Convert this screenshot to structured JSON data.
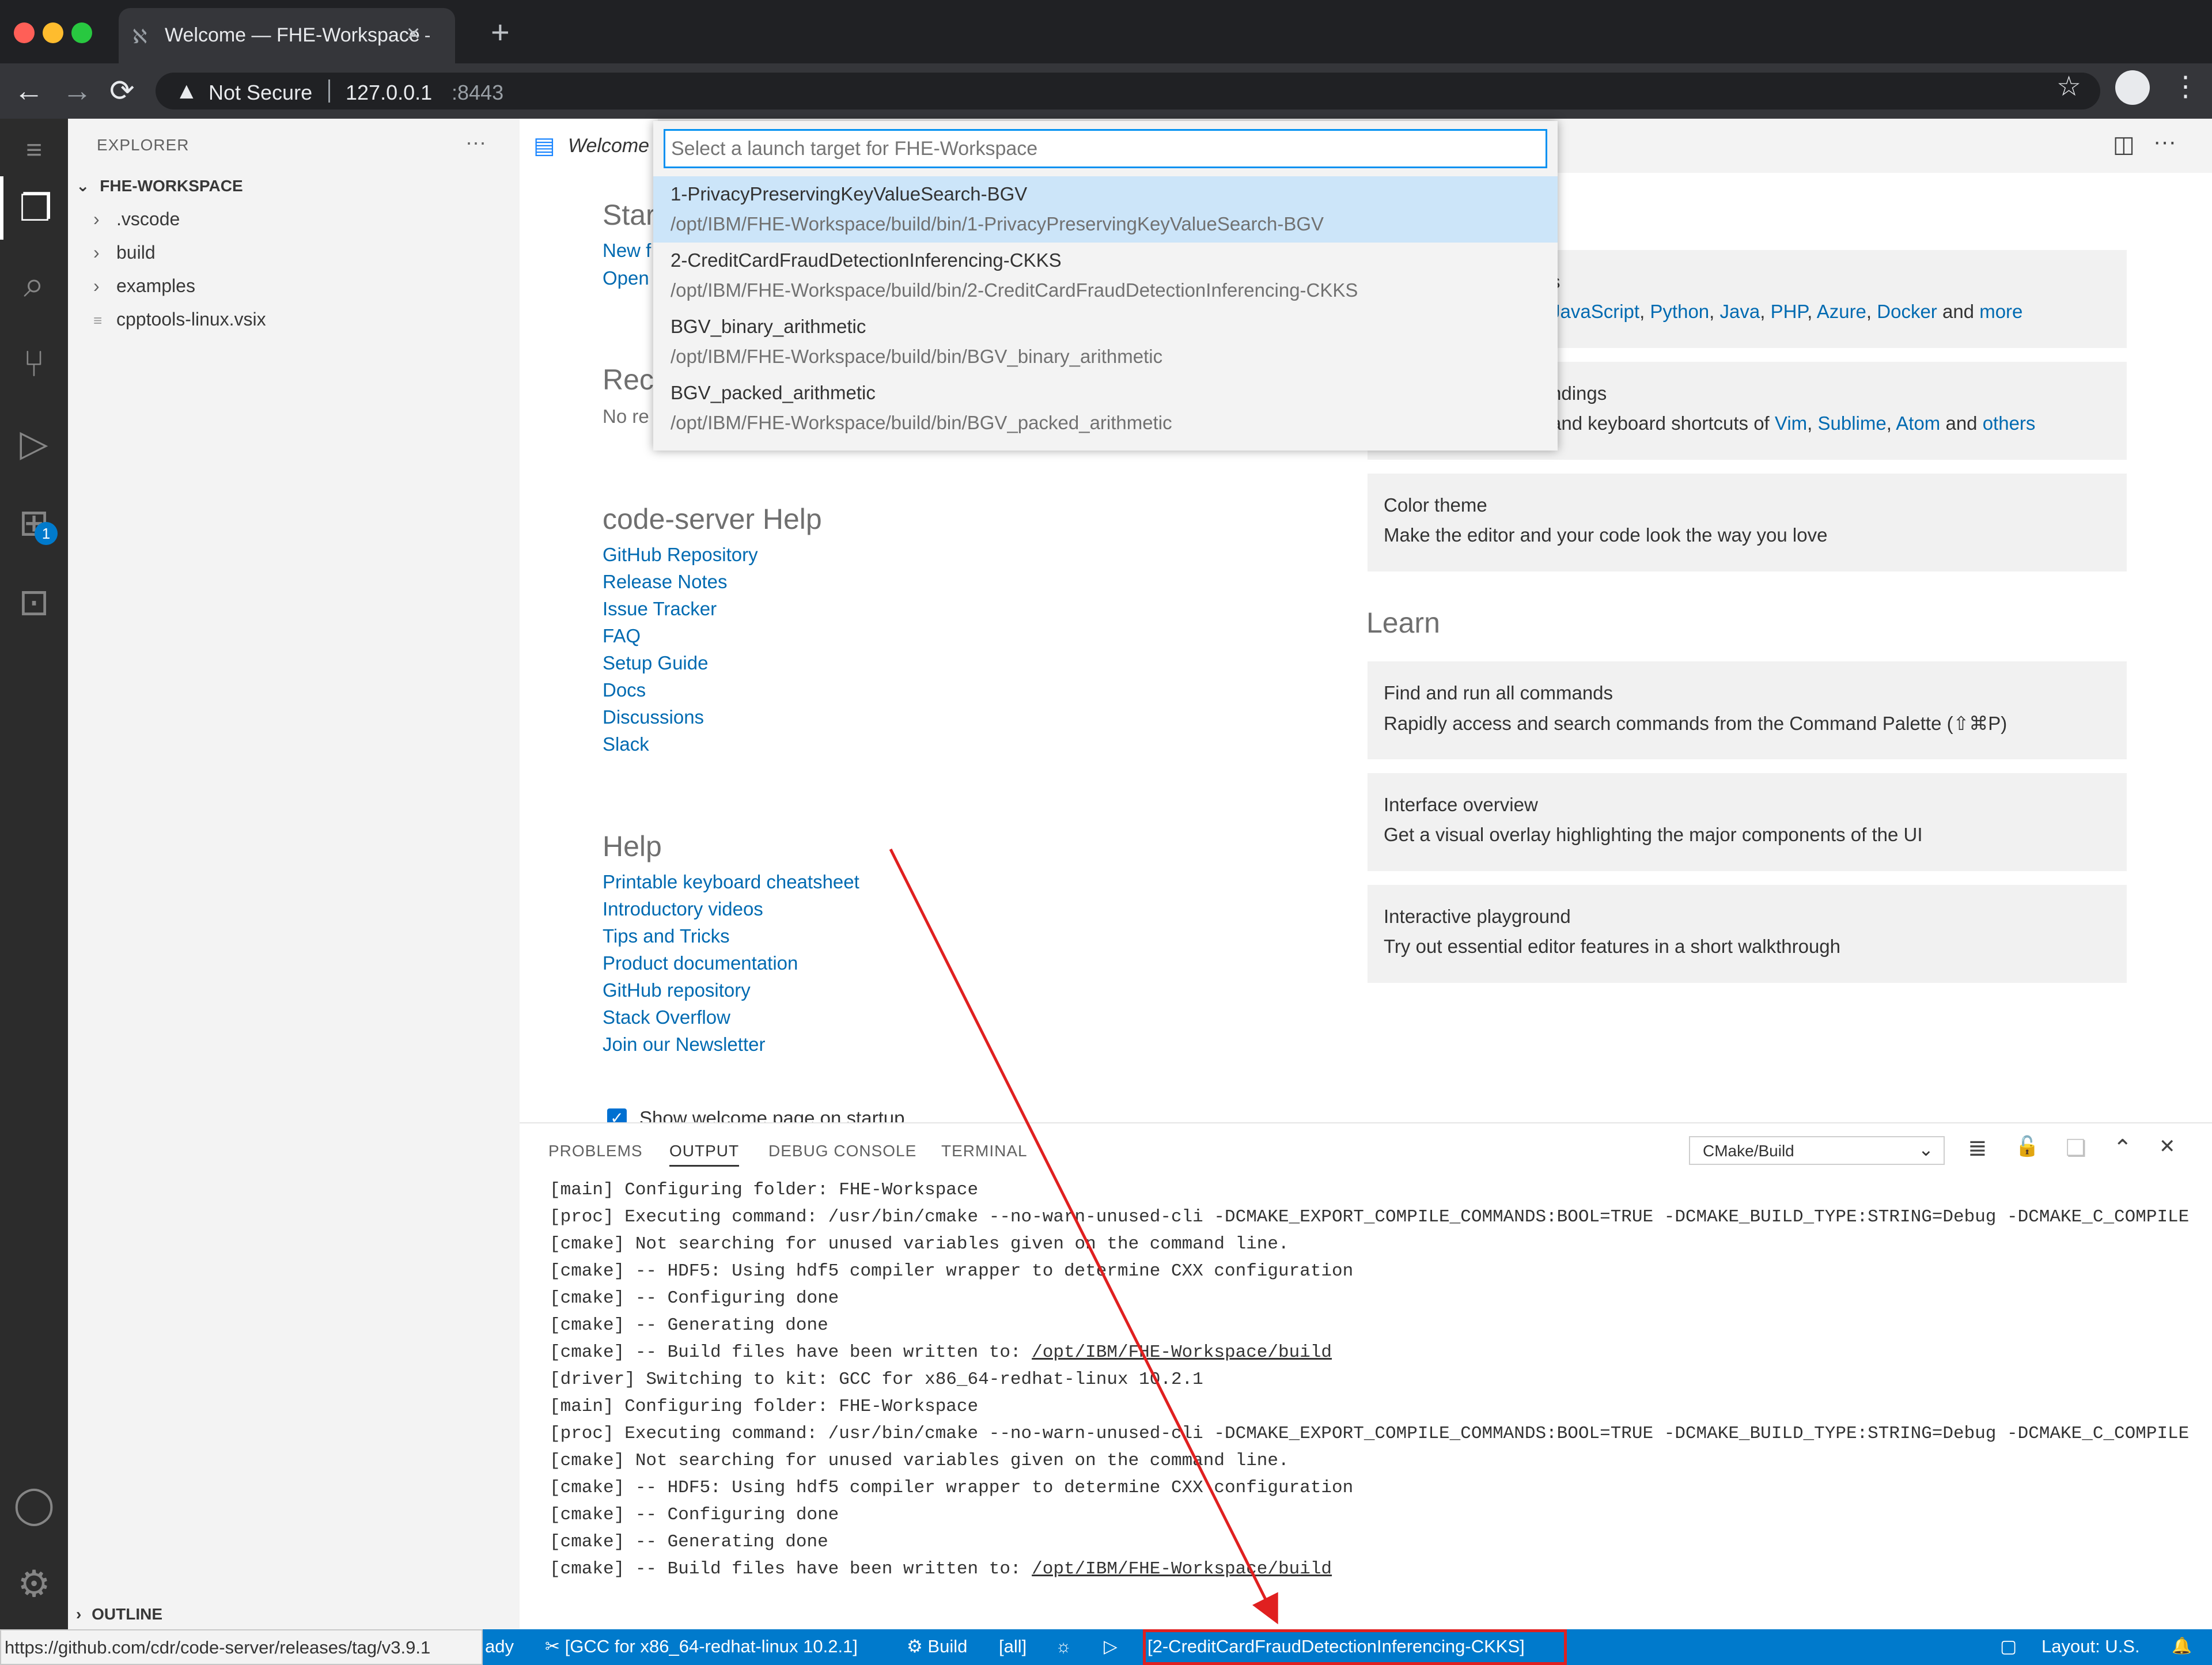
{
  "browser": {
    "tab_title": "Welcome — FHE-Workspace — code-server",
    "close_glyph": "×",
    "newtab_glyph": "+",
    "back_glyph": "←",
    "forward_glyph": "→",
    "reload_glyph": "⟳",
    "security_label": "Not Secure",
    "url_host": "127.0.0.1",
    "url_port": ":8443",
    "star_glyph": "☆",
    "menu_glyph": "⋮",
    "traffic_colors": [
      "#ff5f57",
      "#febc2e",
      "#28c840"
    ]
  },
  "activity": {
    "menu": "≡",
    "explorer": "❐",
    "search": "⌕",
    "scm": "⑂",
    "debug": "▷",
    "extensions": "⊞",
    "extensions_badge": "1",
    "remote": "⊡",
    "accounts": "◯",
    "settings": "⚙"
  },
  "sidebar": {
    "title": "EXPLORER",
    "more": "···",
    "workspace": "FHE-WORKSPACE",
    "items": [
      {
        "chev": "›",
        "label": ".vscode"
      },
      {
        "chev": "›",
        "label": "build"
      },
      {
        "chev": "›",
        "label": "examples"
      },
      {
        "chev": "≡",
        "label": "cpptools-linux.vsix"
      }
    ],
    "outline": "OUTLINE",
    "chev_down": "⌄",
    "chev_right": "›"
  },
  "editor": {
    "tab_label": "Welcome",
    "split": "◫",
    "more": "···"
  },
  "welcome": {
    "start_heading": "Star",
    "new_link": "New f",
    "open_link": "Open",
    "recent_heading": "Rec",
    "recent_text": "No re",
    "cs_help_heading": "code-server Help",
    "cs_help_links": [
      "GitHub Repository",
      "Release Notes",
      "Issue Tracker",
      "FAQ",
      "Setup Guide",
      "Docs",
      "Discussions",
      "Slack"
    ],
    "help_heading": "Help",
    "help_links": [
      "Printable keyboard cheatsheet",
      "Introductory videos",
      "Tips and Tricks",
      "Product documentation",
      "GitHub repository",
      "Stack Overflow",
      "Join our Newsletter"
    ],
    "customize_cards": {
      "tools_title": "s",
      "tools_desc_links": [
        "JavaScript",
        "Python",
        "Java",
        "PHP",
        "Azure",
        "Docker"
      ],
      "tools_and": "and",
      "tools_more": "more",
      "keys_title": "ndings",
      "keys_prefix": "and keyboard shortcuts of",
      "keys_links": [
        "Vim",
        "Sublime",
        "Atom"
      ],
      "keys_and": "and",
      "keys_others": "others",
      "color_title": "Color theme",
      "color_desc": "Make the editor and your code look the way you love"
    },
    "learn_heading": "Learn",
    "learn_cards": [
      {
        "title": "Find and run all commands",
        "desc": "Rapidly access and search commands from the Command Palette (⇧⌘P)"
      },
      {
        "title": "Interface overview",
        "desc": "Get a visual overlay highlighting the major components of the UI"
      },
      {
        "title": "Interactive playground",
        "desc": "Try out essential editor features in a short walkthrough"
      }
    ],
    "startup_check": "✓",
    "startup_label": "Show welcome page on startup"
  },
  "quickpick": {
    "placeholder": "Select a launch target for FHE-Workspace",
    "items": [
      {
        "label": "1-PrivacyPreservingKeyValueSearch-BGV",
        "desc": "/opt/IBM/FHE-Workspace/build/bin/1-PrivacyPreservingKeyValueSearch-BGV"
      },
      {
        "label": "2-CreditCardFraudDetectionInferencing-CKKS",
        "desc": "/opt/IBM/FHE-Workspace/build/bin/2-CreditCardFraudDetectionInferencing-CKKS"
      },
      {
        "label": "BGV_binary_arithmetic",
        "desc": "/opt/IBM/FHE-Workspace/build/bin/BGV_binary_arithmetic"
      },
      {
        "label": "BGV_packed_arithmetic",
        "desc": "/opt/IBM/FHE-Workspace/build/bin/BGV_packed_arithmetic"
      }
    ]
  },
  "panel": {
    "tabs": [
      "PROBLEMS",
      "OUTPUT",
      "DEBUG CONSOLE",
      "TERMINAL"
    ],
    "channel": "CMake/Build",
    "chev": "⌄",
    "icons": {
      "clear": "≣",
      "lock": "🔓",
      "copy": "❏",
      "maximize": "⌃",
      "close": "✕"
    },
    "lines": [
      "[main] Configuring folder: FHE-Workspace",
      "[proc] Executing command: /usr/bin/cmake --no-warn-unused-cli -DCMAKE_EXPORT_COMPILE_COMMANDS:BOOL=TRUE -DCMAKE_BUILD_TYPE:STRING=Debug -DCMAKE_C_COMPILE",
      "[cmake] Not searching for unused variables given on the command line.",
      "[cmake] -- HDF5: Using hdf5 compiler wrapper to determine CXX configuration",
      "[cmake] -- Configuring done",
      "[cmake] -- Generating done",
      "[cmake] -- Build files have been written to: ",
      "[driver] Switching to kit: GCC for x86_64-redhat-linux 10.2.1",
      "[main] Configuring folder: FHE-Workspace",
      "[proc] Executing command: /usr/bin/cmake --no-warn-unused-cli -DCMAKE_EXPORT_COMPILE_COMMANDS:BOOL=TRUE -DCMAKE_BUILD_TYPE:STRING=Debug -DCMAKE_C_COMPILE",
      "[cmake] Not searching for unused variables given on the command line.",
      "[cmake] -- HDF5: Using hdf5 compiler wrapper to determine CXX configuration",
      "[cmake] -- Configuring done",
      "[cmake] -- Generating done",
      "[cmake] -- Build files have been written to: "
    ],
    "build_path": "/opt/IBM/FHE-Workspace/build"
  },
  "status": {
    "hover_link": "https://github.com/cdr/code-server/releases/tag/v3.9.1",
    "ready_fragment": "ady",
    "kit": "✂ [GCC for x86_64-redhat-linux 10.2.1]",
    "build": "⚙ Build",
    "target": "[all]",
    "debug": "☼",
    "run": "▷",
    "launch_target": "[2-CreditCardFraudDetectionInferencing-CKKS]",
    "feedback": "▢",
    "layout": "Layout: U.S.",
    "bell": "🔔"
  },
  "colors": {
    "accent": "#007acc",
    "link": "#006ab1",
    "annotation": "#e02020"
  }
}
